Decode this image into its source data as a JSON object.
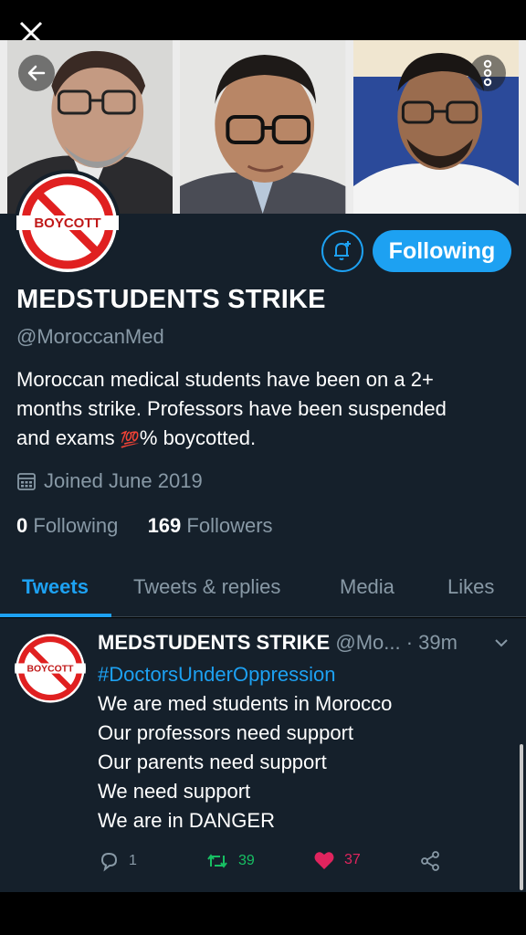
{
  "profile": {
    "follow_label": "Following",
    "name": "MEDSTUDENTS STRIKE",
    "handle": "@MoroccanMed",
    "bio_line1": "Moroccan medical students have been on a 2+",
    "bio_line2": "months strike. Professors have been suspended",
    "bio_line3_a": "and exams ",
    "bio_emoji": "💯",
    "bio_line3_b": "% boycotted.",
    "joined": "Joined June 2019",
    "following_count": "0",
    "following_label": "Following",
    "followers_count": "169",
    "followers_label": "Followers",
    "avatar_text": "BOYCOTT"
  },
  "tabs": [
    "Tweets",
    "Tweets & replies",
    "Media",
    "Likes"
  ],
  "tweet": {
    "name": "MEDSTUDENTS STRIKE",
    "handle": "@Mo...",
    "time": "· 39m",
    "hashtag": "#DoctorsUnderOppression",
    "lines": [
      "We are med students in Morocco",
      "Our professors need support",
      "Our parents need support",
      "We need support",
      "We are in DANGER"
    ],
    "replies": "1",
    "retweets": "39",
    "likes": "37",
    "avatar_text": "BOYCOTT"
  },
  "colors": {
    "accent": "#1da1f2",
    "background": "#15202b",
    "muted": "#8899a6",
    "retweet": "#17bf63",
    "like": "#e0245e"
  }
}
